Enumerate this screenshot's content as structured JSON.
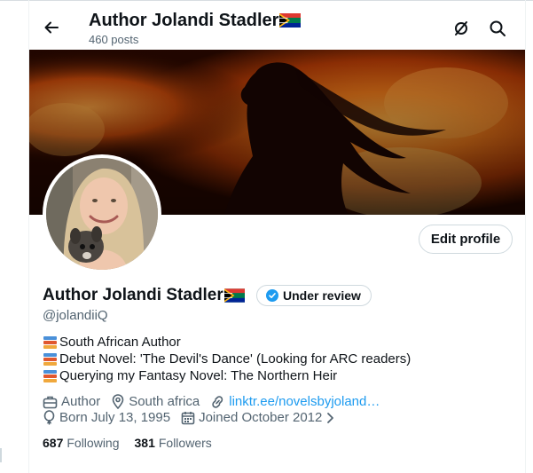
{
  "header": {
    "back_icon": "arrow-left-icon",
    "title": "Author Jolandi Stadler",
    "posts_count": "460 posts",
    "action_icons": [
      "no-signal-icon",
      "search-icon"
    ]
  },
  "profile": {
    "display_name": "Author Jolandi Stadler",
    "verification_label": "Under review",
    "handle": "@jolandiiQ",
    "edit_button_label": "Edit profile",
    "bio_lines": [
      "South African Author",
      "Debut Novel: 'The Devil's Dance' (Looking for ARC readers)",
      "Querying my Fantasy Novel: The Northern Heir"
    ],
    "profession": "Author",
    "location": "South africa",
    "website": "linktr.ee/novelsbyjoland…",
    "birthday": "Born July 13, 1995",
    "joined": "Joined October 2012",
    "following_count": "687",
    "following_label": "Following",
    "followers_count": "381",
    "followers_label": "Followers"
  },
  "colors": {
    "accent": "#1d9bf0",
    "text_primary": "#0f1419",
    "text_secondary": "#536471",
    "border": "#cfd9de"
  }
}
